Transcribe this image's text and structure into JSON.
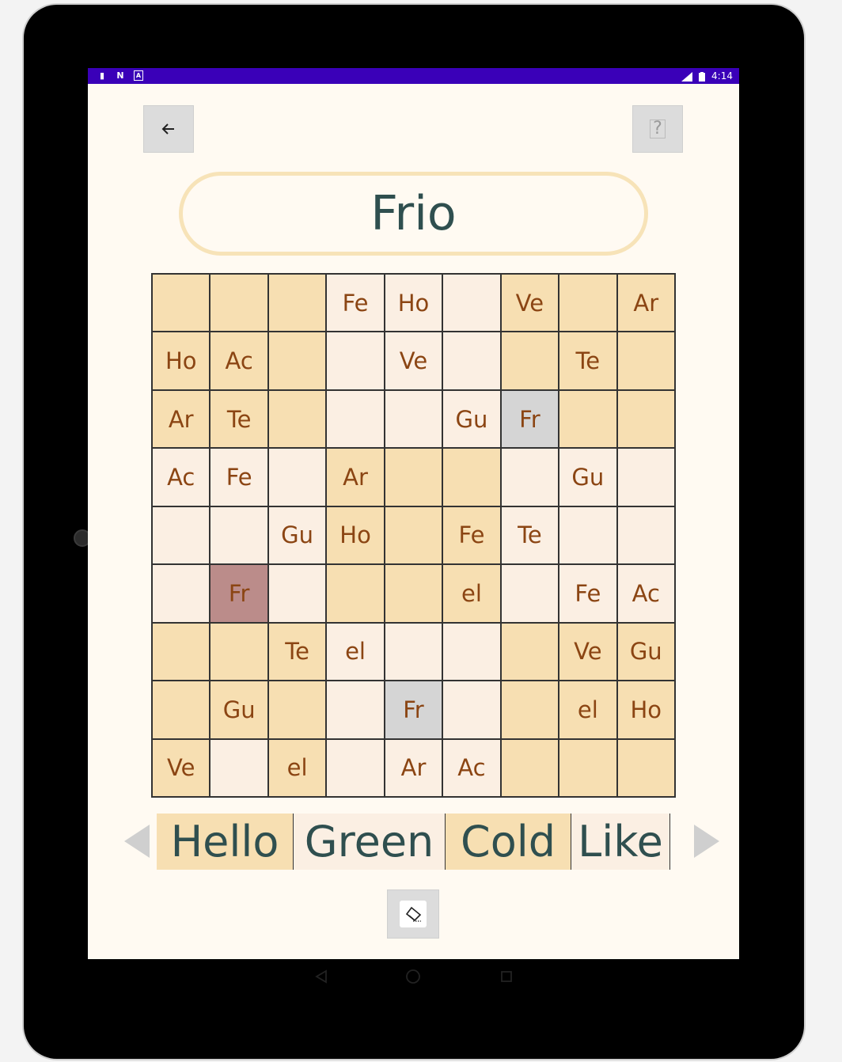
{
  "status_bar": {
    "time": "4:14",
    "network": "LTE"
  },
  "title": "Frio",
  "grid": [
    [
      {
        "t": "",
        "c": "o"
      },
      {
        "t": "",
        "c": "o"
      },
      {
        "t": "",
        "c": "o"
      },
      {
        "t": "Fe",
        "c": "w"
      },
      {
        "t": "Ho",
        "c": "w"
      },
      {
        "t": "",
        "c": "w"
      },
      {
        "t": "Ve",
        "c": "o"
      },
      {
        "t": "",
        "c": "o"
      },
      {
        "t": "Ar",
        "c": "o"
      }
    ],
    [
      {
        "t": "Ho",
        "c": "o"
      },
      {
        "t": "Ac",
        "c": "o"
      },
      {
        "t": "",
        "c": "o"
      },
      {
        "t": "",
        "c": "w"
      },
      {
        "t": "Ve",
        "c": "w"
      },
      {
        "t": "",
        "c": "w"
      },
      {
        "t": "",
        "c": "o"
      },
      {
        "t": "Te",
        "c": "o"
      },
      {
        "t": "",
        "c": "o"
      }
    ],
    [
      {
        "t": "Ar",
        "c": "o"
      },
      {
        "t": "Te",
        "c": "o"
      },
      {
        "t": "",
        "c": "o"
      },
      {
        "t": "",
        "c": "w"
      },
      {
        "t": "",
        "c": "w"
      },
      {
        "t": "Gu",
        "c": "w"
      },
      {
        "t": "Fr",
        "c": "g"
      },
      {
        "t": "",
        "c": "o"
      },
      {
        "t": "",
        "c": "o"
      }
    ],
    [
      {
        "t": "Ac",
        "c": "w"
      },
      {
        "t": "Fe",
        "c": "w"
      },
      {
        "t": "",
        "c": "w"
      },
      {
        "t": "Ar",
        "c": "o"
      },
      {
        "t": "",
        "c": "o"
      },
      {
        "t": "",
        "c": "o"
      },
      {
        "t": "",
        "c": "w"
      },
      {
        "t": "Gu",
        "c": "w"
      },
      {
        "t": "",
        "c": "w"
      }
    ],
    [
      {
        "t": "",
        "c": "w"
      },
      {
        "t": "",
        "c": "w"
      },
      {
        "t": "Gu",
        "c": "w"
      },
      {
        "t": "Ho",
        "c": "o"
      },
      {
        "t": "",
        "c": "o"
      },
      {
        "t": "Fe",
        "c": "o"
      },
      {
        "t": "Te",
        "c": "w"
      },
      {
        "t": "",
        "c": "w"
      },
      {
        "t": "",
        "c": "w"
      }
    ],
    [
      {
        "t": "",
        "c": "w"
      },
      {
        "t": "Fr",
        "c": "r"
      },
      {
        "t": "",
        "c": "w"
      },
      {
        "t": "",
        "c": "o"
      },
      {
        "t": "",
        "c": "o"
      },
      {
        "t": "el",
        "c": "o"
      },
      {
        "t": "",
        "c": "w"
      },
      {
        "t": "Fe",
        "c": "w"
      },
      {
        "t": "Ac",
        "c": "w"
      }
    ],
    [
      {
        "t": "",
        "c": "o"
      },
      {
        "t": "",
        "c": "o"
      },
      {
        "t": "Te",
        "c": "o"
      },
      {
        "t": "el",
        "c": "w"
      },
      {
        "t": "",
        "c": "w"
      },
      {
        "t": "",
        "c": "w"
      },
      {
        "t": "",
        "c": "o"
      },
      {
        "t": "Ve",
        "c": "o"
      },
      {
        "t": "Gu",
        "c": "o"
      }
    ],
    [
      {
        "t": "",
        "c": "o"
      },
      {
        "t": "Gu",
        "c": "o"
      },
      {
        "t": "",
        "c": "o"
      },
      {
        "t": "",
        "c": "w"
      },
      {
        "t": "Fr",
        "c": "g"
      },
      {
        "t": "",
        "c": "w"
      },
      {
        "t": "",
        "c": "o"
      },
      {
        "t": "el",
        "c": "o"
      },
      {
        "t": "Ho",
        "c": "o"
      }
    ],
    [
      {
        "t": "Ve",
        "c": "o"
      },
      {
        "t": "",
        "c": "w"
      },
      {
        "t": "el",
        "c": "o"
      },
      {
        "t": "",
        "c": "w"
      },
      {
        "t": "Ar",
        "c": "w"
      },
      {
        "t": "Ac",
        "c": "w"
      },
      {
        "t": "",
        "c": "o"
      },
      {
        "t": "",
        "c": "o"
      },
      {
        "t": "",
        "c": "o"
      }
    ]
  ],
  "words": [
    {
      "label": "Hello",
      "style": "o"
    },
    {
      "label": "Green",
      "style": "w"
    },
    {
      "label": "Cold",
      "style": "o"
    },
    {
      "label": "Like",
      "style": "w"
    }
  ],
  "colors": {
    "accent_orange": "#f7dfb2",
    "light_cell": "#fbefe3",
    "selected_gray": "#d5d5d5",
    "found_red": "#bb8c8a",
    "text_brown": "#8b4513",
    "title_text": "#2f4f4f",
    "status_bar": "#3a00b8"
  },
  "icons": {
    "back": "arrow-left-icon",
    "help": "question-icon",
    "eraser": "eraser-icon"
  }
}
